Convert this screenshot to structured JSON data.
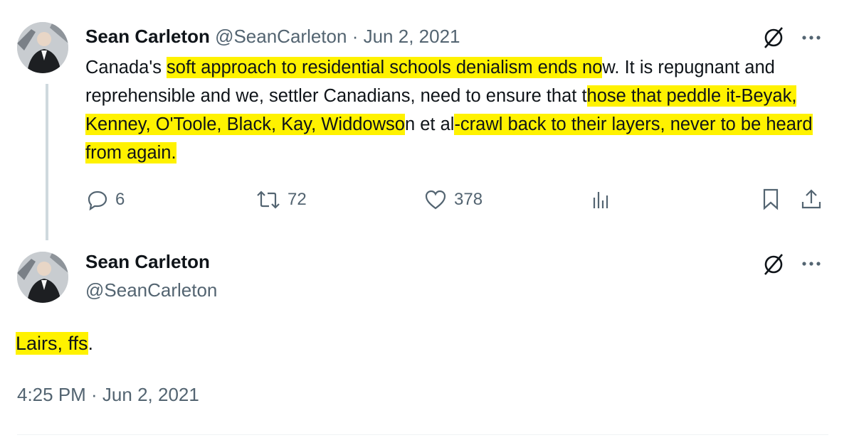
{
  "tweet1": {
    "display_name": "Sean Carleton",
    "handle": "@SeanCarleton",
    "separator": "·",
    "date": "Jun 2, 2021",
    "text_parts": [
      "Canada's ",
      "soft approach to residential schools denialism ends no",
      "w. It is repugnant and reprehensible and we, settler Canadians, need to ensure that t",
      "hose that peddle it-Beyak, Kenney, O'Toole, Black, Kay, Widdowso",
      "n et al",
      "-crawl back to their layers, never to be heard from again."
    ],
    "actions": {
      "replies": "6",
      "reposts": "72",
      "likes": "378"
    }
  },
  "tweet2": {
    "display_name": "Sean Carleton",
    "handle": "@SeanCarleton",
    "text_highlight": "Lairs, ffs",
    "text_rest": ".",
    "timestamp": "4:25 PM · Jun 2, 2021"
  },
  "icons": {
    "grok": "grok-icon",
    "more": "more-icon",
    "reply": "reply-icon",
    "repost": "repost-icon",
    "like": "heart-icon",
    "views": "analytics-icon",
    "bookmark": "bookmark-icon",
    "share": "share-icon"
  },
  "colors": {
    "highlight": "#fff200",
    "muted": "#536471",
    "text": "#0f1419"
  }
}
